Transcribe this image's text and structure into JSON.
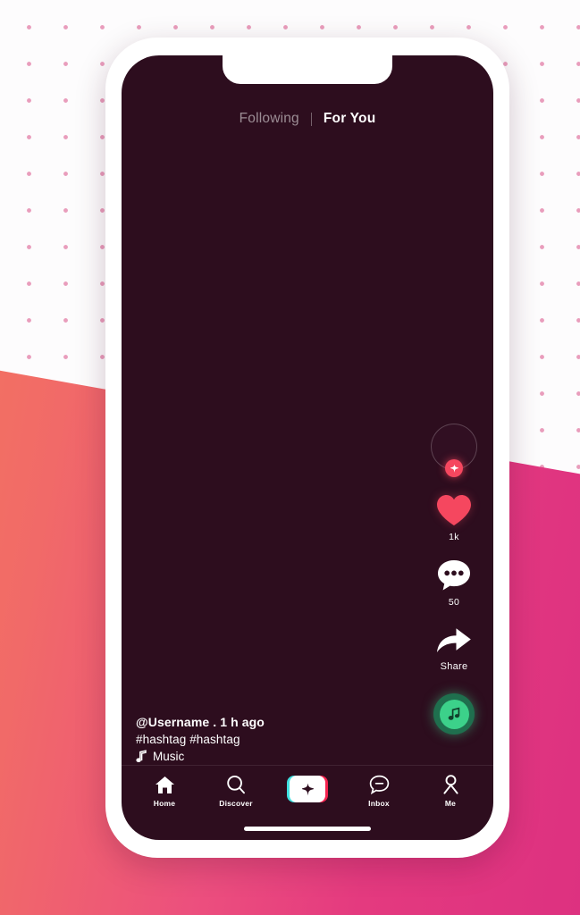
{
  "app": {
    "name": "TikTok Feed Mockup",
    "screen_background": "#2d0d1e",
    "accent_pink": "#f5475f",
    "accent_green": "#3cd18a",
    "accent_cyan": "#3fe0e0",
    "accent_red": "#f5224e"
  },
  "background": {
    "base_color": "#fdfcfd",
    "dot_color": "#e58cb0",
    "gradient_from": "#f4745f",
    "gradient_to": "#dd3180"
  },
  "header": {
    "tabs": [
      {
        "label": "Following",
        "active": false
      },
      {
        "label": "For You",
        "active": true
      }
    ]
  },
  "actions": {
    "avatar": {
      "icon": "avatar-icon",
      "badge_icon": "plus-icon"
    },
    "like": {
      "icon": "heart-icon",
      "count": "1k"
    },
    "comment": {
      "icon": "comment-bubble-icon",
      "count": "50"
    },
    "share": {
      "icon": "share-arrow-icon",
      "label": "Share"
    },
    "music_disc": {
      "icon": "music-note-icon"
    }
  },
  "caption": {
    "username": "@Username . 1 h ago",
    "hashtags": "#hashtag  #hashtag",
    "music_label": "Music",
    "music_icon": "tiktok-note-icon"
  },
  "navbar": {
    "items": [
      {
        "label": "Home",
        "icon": "home-icon"
      },
      {
        "label": "Discover",
        "icon": "search-icon"
      },
      {
        "label": "",
        "icon": "create-plus-icon"
      },
      {
        "label": "Inbox",
        "icon": "inbox-bubble-icon"
      },
      {
        "label": "Me",
        "icon": "person-icon"
      }
    ]
  }
}
